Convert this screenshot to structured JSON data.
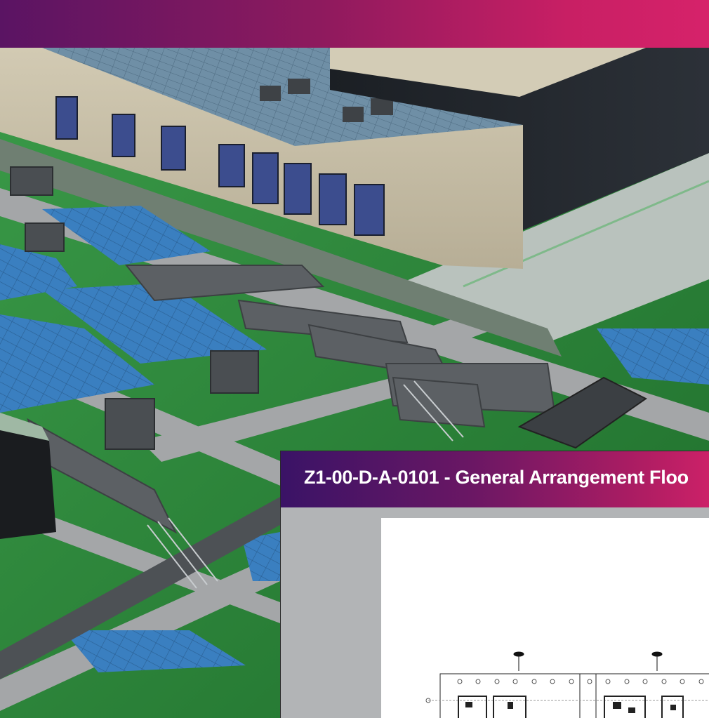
{
  "header": {
    "color_start": "#5a1463",
    "color_end": "#d6226a"
  },
  "scene": {
    "description_icon": "3d-building-model-view"
  },
  "document_viewer": {
    "title": "Z1-00-D-A-0101 - General Arrangement Floo",
    "title_bar_color_start": "#3a1366",
    "title_bar_color_end": "#cc2168",
    "sheet_icon": "floor-plan-drawing"
  },
  "colors": {
    "roof_green": "#2f8a3c",
    "panel_blue": "#3b7fbf",
    "walkway_gray": "#9a9c9e",
    "wall_beige": "#c9c0a8"
  }
}
